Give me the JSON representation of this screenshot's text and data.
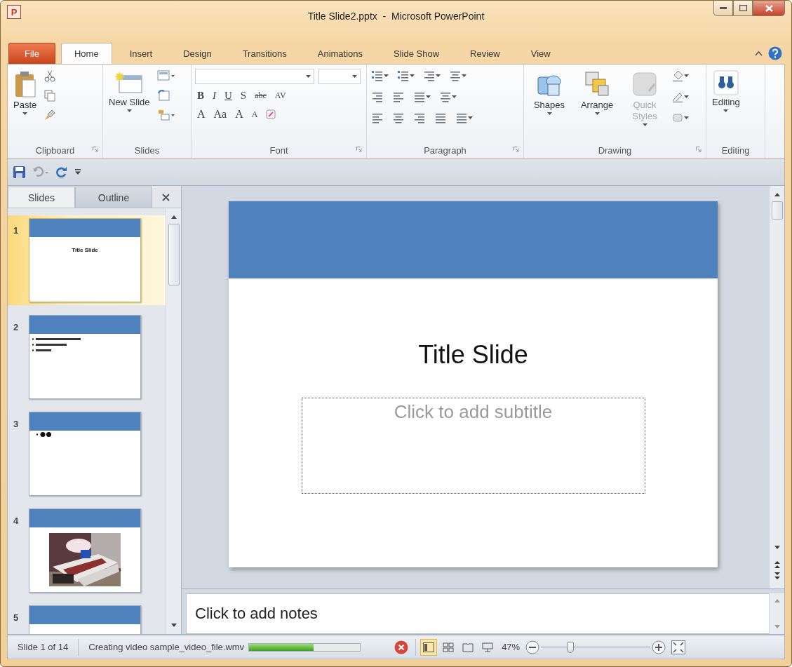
{
  "window": {
    "app_icon": "P",
    "title": "Title Slide2.pptx  -  Microsoft PowerPoint"
  },
  "ribbon": {
    "tabs": [
      {
        "label": "File",
        "kind": "file",
        "selected": false
      },
      {
        "label": "Home",
        "kind": "tab",
        "selected": true
      },
      {
        "label": "Insert",
        "kind": "tab",
        "selected": false
      },
      {
        "label": "Design",
        "kind": "tab",
        "selected": false
      },
      {
        "label": "Transitions",
        "kind": "tab",
        "selected": false
      },
      {
        "label": "Animations",
        "kind": "tab",
        "selected": false
      },
      {
        "label": "Slide Show",
        "kind": "tab",
        "selected": false
      },
      {
        "label": "Review",
        "kind": "tab",
        "selected": false
      },
      {
        "label": "View",
        "kind": "tab",
        "selected": false
      }
    ],
    "groups": [
      {
        "kind": "clipboard",
        "label": "Clipboard",
        "launcher": true,
        "large": [
          {
            "label": "Paste",
            "disabled": false
          }
        ]
      },
      {
        "kind": "slides",
        "label": "Slides",
        "launcher": false,
        "large": [
          {
            "label": "New Slide",
            "disabled": false
          }
        ]
      },
      {
        "kind": "font",
        "label": "Font",
        "launcher": true,
        "format_buttons": [
          {
            "kind": "bold",
            "label": "B"
          },
          {
            "kind": "italic",
            "label": "I"
          },
          {
            "kind": "underline",
            "label": "U"
          },
          {
            "kind": "shadow",
            "label": "S"
          },
          {
            "kind": "strike",
            "label": "abc"
          },
          {
            "kind": "spacing",
            "label": "AV"
          }
        ],
        "size_buttons": [
          {
            "kind": "color",
            "label": "A"
          },
          {
            "kind": "case",
            "label": "Aa"
          },
          {
            "kind": "grow",
            "label": "A"
          },
          {
            "kind": "shrink",
            "label": "A"
          }
        ]
      },
      {
        "kind": "paragraph",
        "label": "Paragraph",
        "launcher": true
      },
      {
        "kind": "drawing",
        "label": "Drawing",
        "launcher": true,
        "large": [
          {
            "label": "Shapes",
            "disabled": false
          },
          {
            "label": "Arrange",
            "disabled": false
          },
          {
            "label": "Quick Styles",
            "disabled": true
          }
        ]
      },
      {
        "kind": "editing",
        "label": "Editing",
        "launcher": false,
        "large": [
          {
            "label": "Editing",
            "disabled": false
          }
        ]
      }
    ]
  },
  "slide_panel": {
    "tabs": [
      {
        "label": "Slides",
        "selected": true
      },
      {
        "label": "Outline",
        "selected": false
      }
    ],
    "slides": [
      {
        "number": "1",
        "kind": "title",
        "title": "Title Slide",
        "selected": true
      },
      {
        "number": "2",
        "kind": "bullets",
        "selected": false
      },
      {
        "number": "3",
        "kind": "dots",
        "selected": false
      },
      {
        "number": "4",
        "kind": "picture",
        "selected": false
      },
      {
        "number": "5",
        "kind": "title",
        "selected": false
      }
    ]
  },
  "slide": {
    "title": "Title Slide",
    "subtitle": {
      "placeholder": "Click to add subtitle"
    }
  },
  "notes": {
    "placeholder": "Click to add notes"
  },
  "status_bar": {
    "slide_info": "Slide 1 of 14",
    "task": "Creating video sample_video_file.wmv",
    "progress": {
      "level": 0.58
    },
    "views": [
      {
        "kind": "normal",
        "selected": true
      },
      {
        "kind": "sorter",
        "selected": false
      },
      {
        "kind": "reading",
        "selected": false
      },
      {
        "kind": "slideshow",
        "selected": false
      }
    ],
    "zoom": "47%",
    "zoom_slider": {
      "level": 0.27
    }
  }
}
